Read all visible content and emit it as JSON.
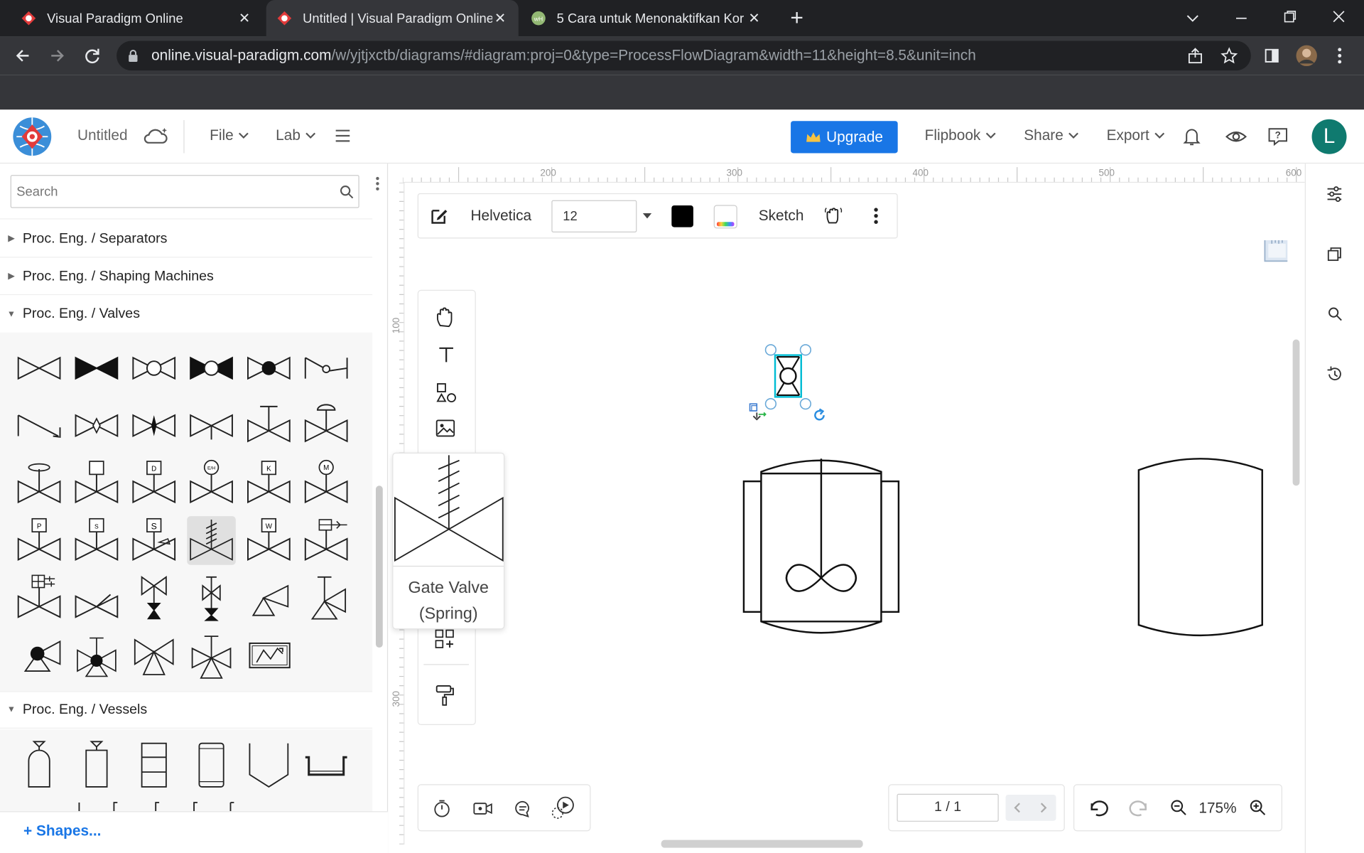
{
  "browser": {
    "tabs": [
      {
        "title": "Visual Paradigm Online",
        "close": "✕"
      },
      {
        "title": "Untitled | Visual Paradigm Online",
        "close": "✕"
      },
      {
        "title": "5 Cara untuk Menonaktifkan Kor",
        "close": "✕"
      }
    ],
    "new_tab": "+",
    "url_host": "online.visual-paradigm.com",
    "url_path": "/w/yjtjxctb/diagrams/#diagram:proj=0&type=ProcessFlowDiagram&width=11&height=8.5&unit=inch",
    "profile_color": "#8a6a4a"
  },
  "app": {
    "doc_title": "Untitled",
    "menus": {
      "file": "File",
      "lab": "Lab"
    },
    "upgrade": "Upgrade",
    "right_menus": {
      "flipbook": "Flipbook",
      "share": "Share",
      "export": "Export"
    },
    "avatar_letter": "L",
    "avatar_color": "#0f7a6f",
    "accent": "#1976e6"
  },
  "sidebar": {
    "search_placeholder": "Search",
    "categories": {
      "separators": "Proc. Eng. / Separators",
      "shaping": "Proc. Eng. / Shaping Machines",
      "valves": "Proc. Eng. / Valves",
      "vessels": "Proc. Eng. / Vessels"
    },
    "shapes_link": "+ Shapes..."
  },
  "format_bar": {
    "font": "Helvetica",
    "size": "12",
    "sketch": "Sketch"
  },
  "ruler": {
    "top": [
      "200",
      "300",
      "400",
      "500",
      "600"
    ],
    "left": [
      "100",
      "300"
    ]
  },
  "tooltip": {
    "line1": "Gate Valve",
    "line2": "(Spring)"
  },
  "footer": {
    "page": "1 / 1",
    "zoom": "175%"
  }
}
